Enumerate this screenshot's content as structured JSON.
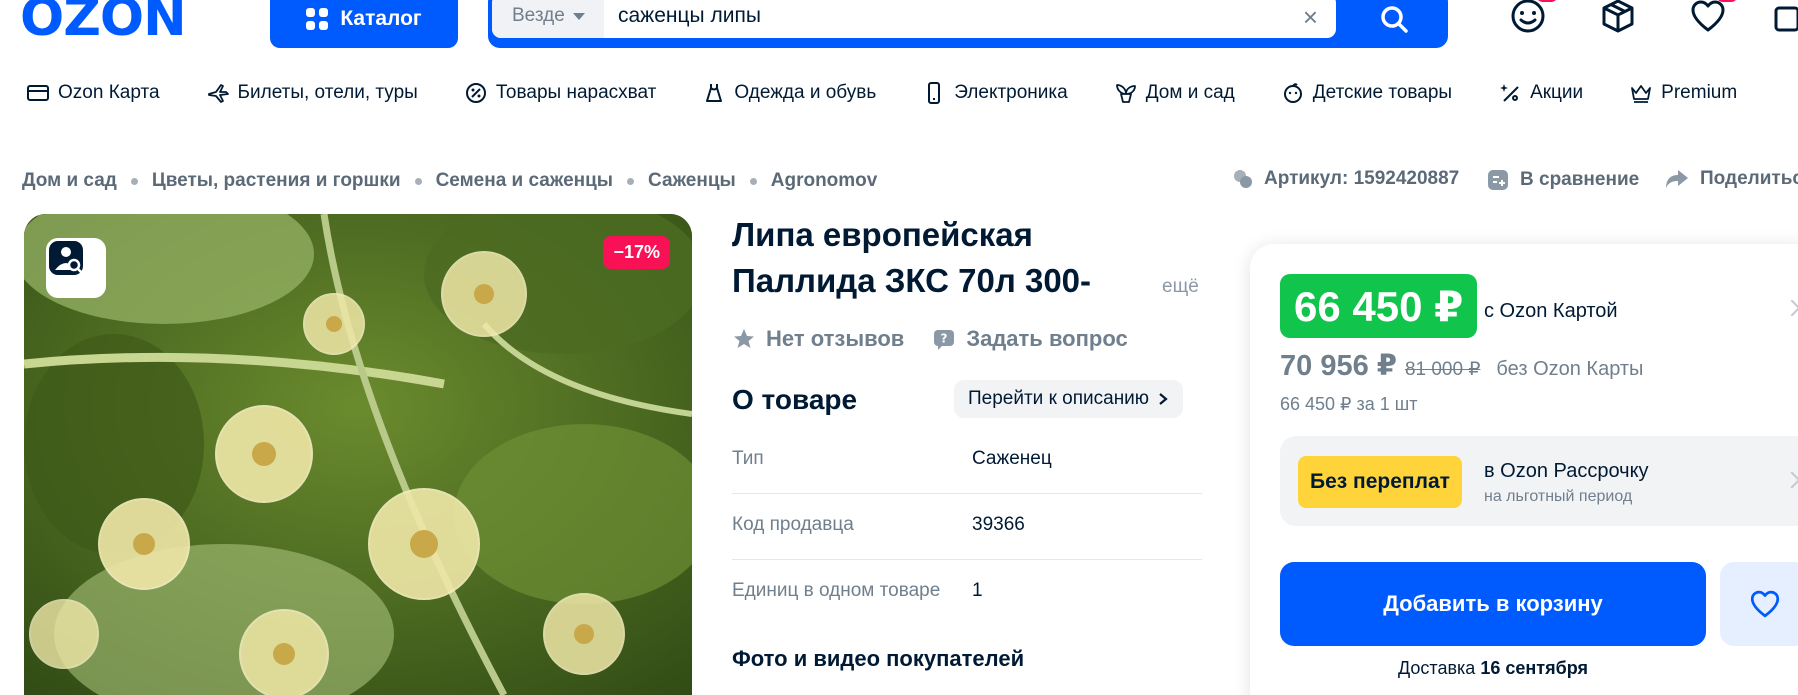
{
  "header": {
    "logo": "OZON",
    "catalog_label": "Каталог",
    "search": {
      "scope": "Везде",
      "value": "саженцы липы",
      "clear": "×"
    },
    "icons": [
      "smile-icon",
      "box-icon",
      "heart-icon",
      "cart-icon"
    ]
  },
  "nav": {
    "items": [
      {
        "label": "Ozon Карта",
        "icon": "card-icon"
      },
      {
        "label": "Билеты, отели, туры",
        "icon": "plane-icon"
      },
      {
        "label": "Товары нарасхват",
        "icon": "percent-icon"
      },
      {
        "label": "Одежда и обувь",
        "icon": "dress-icon"
      },
      {
        "label": "Электроника",
        "icon": "phone-icon"
      },
      {
        "label": "Дом и сад",
        "icon": "plant-icon"
      },
      {
        "label": "Детские товары",
        "icon": "baby-icon"
      },
      {
        "label": "Акции",
        "icon": "sparkle-percent-icon"
      },
      {
        "label": "Premium",
        "icon": "crown-icon"
      }
    ]
  },
  "breadcrumb": [
    "Дом и сад",
    "Цветы, растения и горшки",
    "Семена и саженцы",
    "Саженцы",
    "Agronomov"
  ],
  "meta": {
    "article": "Артикул: 1592420887",
    "compare": "В сравнение",
    "share": "Поделиться"
  },
  "product": {
    "discount": "−17%",
    "title_line1": "Липа европейская",
    "title_line2": "Паллида ЗКС 70л 300-",
    "more": "ещё",
    "no_reviews": "Нет отзывов",
    "ask_question": "Задать вопрос",
    "about_title": "О товаре",
    "goto_description": "Перейти к описанию",
    "specs": [
      {
        "key": "Тип",
        "value": "Саженец"
      },
      {
        "key": "Код продавца",
        "value": "39366"
      },
      {
        "key": "Единиц в одном товаре",
        "value": "1"
      }
    ],
    "photos_title": "Фото и видео покупателей"
  },
  "price": {
    "card_price": "66 450 ₽",
    "with_card": "с Ozon Картой",
    "no_card_price": "70 956 ₽",
    "old_price": "81 000 ₽",
    "no_card_label": "без Ozon Карты",
    "per_unit": "66 450 ₽ за 1 шт",
    "installment_badge": "Без переплат",
    "installment_title": "в Ozon Рассрочку",
    "installment_sub": "на льготный период",
    "add_to_cart": "Добавить в корзину",
    "delivery_prefix": "Доставка",
    "delivery_date": "16 сентября"
  },
  "colors": {
    "brand": "#005bff",
    "green": "#10c44c",
    "discount": "#f91155",
    "yellow": "#ffd43b"
  }
}
